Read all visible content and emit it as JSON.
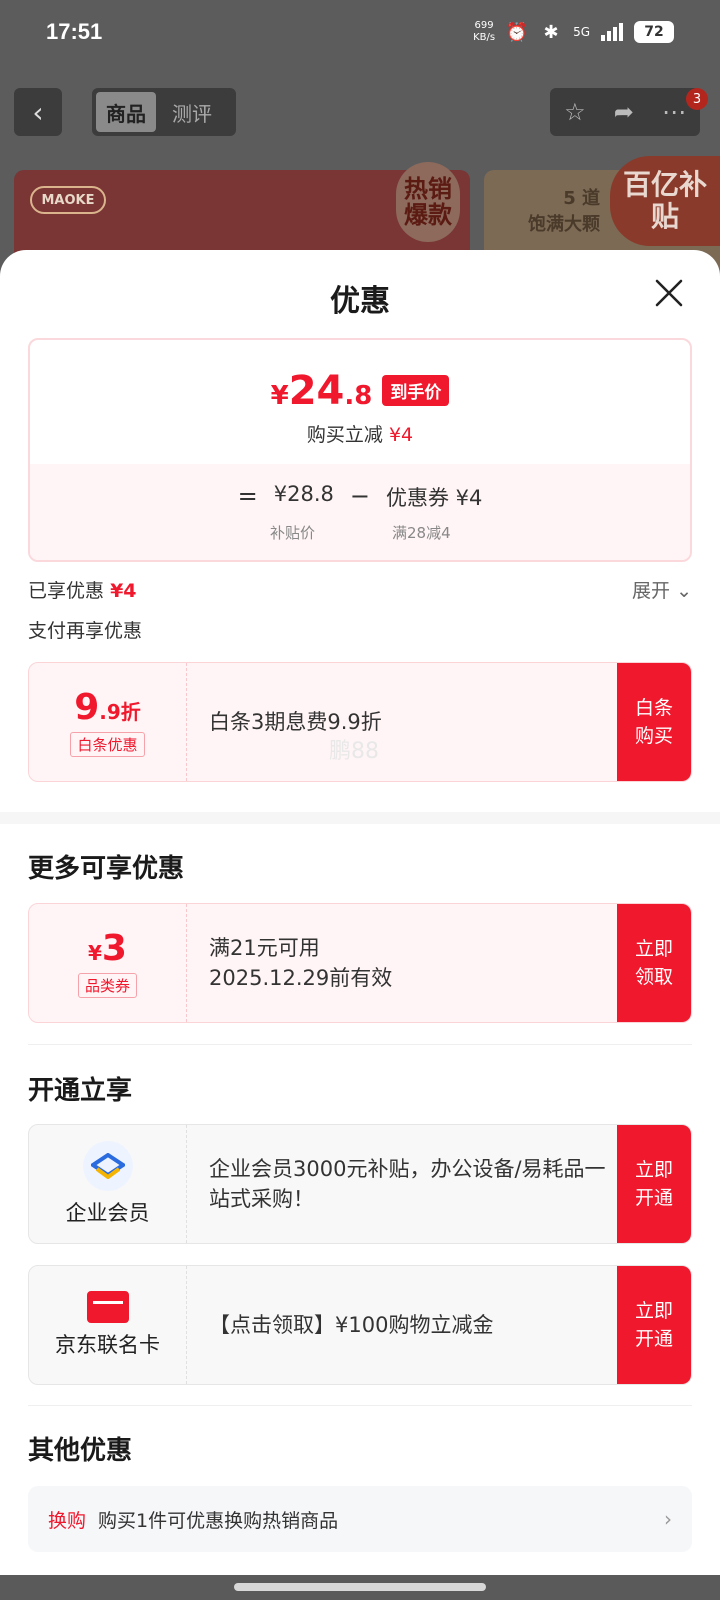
{
  "status_bar": {
    "time": "17:51",
    "net_speed": "699",
    "net_unit": "KB/s",
    "signal": "5G",
    "battery": "72"
  },
  "header": {
    "back": "‹",
    "tabs": [
      "商品",
      "测评"
    ],
    "badge": "3"
  },
  "banner": {
    "brand": "MAOKE",
    "hot": "热销爆款",
    "right_text_1": "5 道",
    "right_text_2": "饱满大颗",
    "subsidy": "百亿补贴"
  },
  "sheet": {
    "title": "优惠",
    "price": {
      "yen": "¥",
      "int": "24",
      "dec": ".8",
      "tag": "到手价",
      "sub_label": "购买立减",
      "sub_value": "¥4"
    },
    "formula": {
      "eq": "=",
      "base": "¥28.8",
      "minus": "−",
      "coupon": "优惠券 ¥4",
      "base_label": "补贴价",
      "coupon_label": "满28减4"
    },
    "enjoyed": {
      "label": "已享优惠",
      "value": "¥4",
      "expand": "展开 ⌄"
    },
    "pay_title": "支付再享优惠",
    "baitiao": {
      "big": "9",
      "small": ".9折",
      "tag": "白条优惠",
      "desc": "白条3期息费9.9折",
      "watermark": "鹏88",
      "cta": "白条购买"
    },
    "more_title": "更多可享优惠",
    "category_coupon": {
      "yen": "¥",
      "amount": "3",
      "tag": "品类券",
      "line1": "满21元可用",
      "line2": "2025.12.29前有效",
      "cta": "立即领取"
    },
    "open_title": "开通立享",
    "enterprise": {
      "label": "企业会员",
      "desc": "企业会员3000元补贴，办公设备/易耗品一站式采购！",
      "cta": "立即开通"
    },
    "jd_card": {
      "label": "京东联名卡",
      "desc": "【点击领取】¥100购物立减金",
      "cta": "立即开通"
    },
    "other_title": "其他优惠",
    "other_row": {
      "tag": "换购",
      "text": "购买1件可优惠换购热销商品",
      "arrow": "›"
    }
  }
}
